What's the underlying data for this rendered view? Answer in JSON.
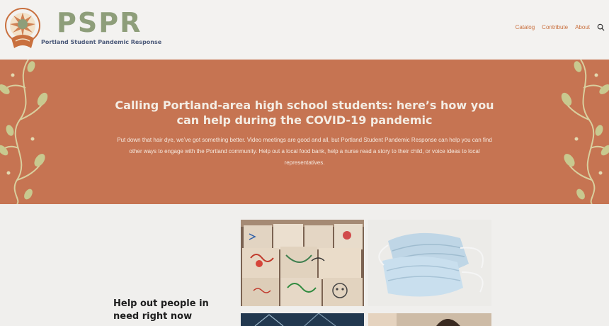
{
  "header": {
    "brand_name": "PSPR",
    "brand_tagline": "Portland Student Pandemic Response",
    "nav": [
      {
        "label": "Catalog"
      },
      {
        "label": "Contribute"
      },
      {
        "label": "About"
      }
    ],
    "search_icon": "search-icon"
  },
  "hero": {
    "title": "Calling Portland-area high school students: here’s how you can help during the COVID-19 pandemic",
    "body": "Put down that hair dye, we’ve got something better. Video meetings are good and all, but Portland Student Pandemic Response can help you can find other ways to engage with the Portland community. Help out a local food bank, help a nurse read a story to their child, or voice ideas to local representatives."
  },
  "section": {
    "heading": "Help out people in need right now"
  },
  "colors": {
    "hero_bg": "#c67452",
    "brand": "#8e9e7a",
    "nav_link": "#c9703e",
    "page_bg": "#f0efed"
  }
}
